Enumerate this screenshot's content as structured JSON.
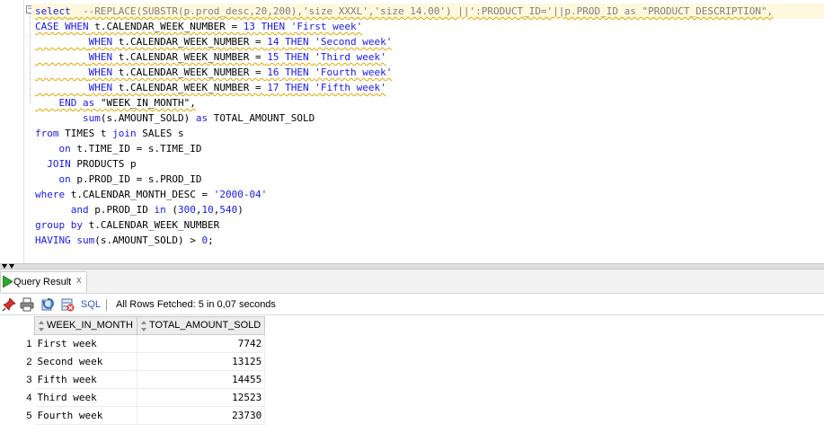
{
  "editor": {
    "lines": [
      {
        "segs": [
          [
            "kw",
            "select"
          ],
          [
            "",
            "  "
          ],
          [
            "cm",
            "--REPLACE(SUBSTR(p.prod_desc,20,200),'size XXXL','size 14.00') ||':PRODUCT_ID='||p.PROD_ID as \"PRODUCT_DESCRIPTION\","
          ]
        ],
        "hl": true,
        "squiggle": true
      },
      {
        "segs": [
          [
            "kw",
            "CASE WHEN"
          ],
          [
            "",
            " t.CALENDAR_WEEK_NUMBER = "
          ],
          [
            "num",
            "13"
          ],
          [
            "kw",
            " THEN "
          ],
          [
            "str",
            "'First week'"
          ]
        ],
        "hl": false,
        "squiggle": true
      },
      {
        "segs": [
          [
            "",
            "         "
          ],
          [
            "kw",
            "WHEN"
          ],
          [
            "",
            " t.CALENDAR_WEEK_NUMBER = "
          ],
          [
            "num",
            "14"
          ],
          [
            "kw",
            " THEN "
          ],
          [
            "str",
            "'Second week'"
          ]
        ],
        "hl": false,
        "squiggle": true
      },
      {
        "segs": [
          [
            "",
            "         "
          ],
          [
            "kw",
            "WHEN"
          ],
          [
            "",
            " t.CALENDAR_WEEK_NUMBER = "
          ],
          [
            "num",
            "15"
          ],
          [
            "kw",
            " THEN "
          ],
          [
            "str",
            "'Third week'"
          ]
        ],
        "hl": false,
        "squiggle": true
      },
      {
        "segs": [
          [
            "",
            "         "
          ],
          [
            "kw",
            "WHEN"
          ],
          [
            "",
            " t.CALENDAR_WEEK_NUMBER = "
          ],
          [
            "num",
            "16"
          ],
          [
            "kw",
            " THEN "
          ],
          [
            "str",
            "'Fourth week'"
          ]
        ],
        "hl": false,
        "squiggle": true
      },
      {
        "segs": [
          [
            "",
            "         "
          ],
          [
            "kw",
            "WHEN"
          ],
          [
            "",
            " t.CALENDAR_WEEK_NUMBER = "
          ],
          [
            "num",
            "17"
          ],
          [
            "kw",
            " THEN "
          ],
          [
            "str",
            "'Fifth week'"
          ]
        ],
        "hl": false,
        "squiggle": true
      },
      {
        "segs": [
          [
            "",
            "    "
          ],
          [
            "kw",
            "END"
          ],
          [
            "kw",
            " as "
          ],
          [
            "",
            "\"WEEK_IN_MONTH\","
          ]
        ],
        "hl": false,
        "squiggle": true
      },
      {
        "segs": [
          [
            "",
            "        "
          ],
          [
            "kw",
            "sum"
          ],
          [
            "",
            "(s.AMOUNT_SOLD) "
          ],
          [
            "kw",
            "as"
          ],
          [
            "",
            " TOTAL_AMOUNT_SOLD"
          ]
        ],
        "hl": false,
        "squiggle": false
      },
      {
        "segs": [
          [
            "kw",
            "from"
          ],
          [
            "",
            " TIMES t "
          ],
          [
            "kw",
            "join"
          ],
          [
            "",
            " SALES s"
          ]
        ],
        "hl": false,
        "squiggle": false
      },
      {
        "segs": [
          [
            "",
            "    "
          ],
          [
            "kw",
            "on"
          ],
          [
            "",
            " t.TIME_ID = s.TIME_ID"
          ]
        ],
        "hl": false,
        "squiggle": false
      },
      {
        "segs": [
          [
            "",
            "  "
          ],
          [
            "kw",
            "JOIN"
          ],
          [
            "",
            " PRODUCTS p"
          ]
        ],
        "hl": false,
        "squiggle": false
      },
      {
        "segs": [
          [
            "",
            "    "
          ],
          [
            "kw",
            "on"
          ],
          [
            "",
            " p.PROD_ID = s.PROD_ID"
          ]
        ],
        "hl": false,
        "squiggle": false
      },
      {
        "segs": [
          [
            "kw",
            "where"
          ],
          [
            "",
            " t.CALENDAR_MONTH_DESC = "
          ],
          [
            "str",
            "'2000-04'"
          ]
        ],
        "hl": false,
        "squiggle": false
      },
      {
        "segs": [
          [
            "",
            "      "
          ],
          [
            "kw",
            "and"
          ],
          [
            "",
            " p.PROD_ID "
          ],
          [
            "kw",
            "in"
          ],
          [
            "",
            " ("
          ],
          [
            "num",
            "300"
          ],
          [
            "",
            ","
          ],
          [
            "num",
            "10"
          ],
          [
            "",
            ","
          ],
          [
            "num",
            "540"
          ],
          [
            "",
            ")"
          ]
        ],
        "hl": false,
        "squiggle": false
      },
      {
        "segs": [
          [
            "kw",
            "group by"
          ],
          [
            "",
            " t.CALENDAR_WEEK_NUMBER"
          ]
        ],
        "hl": false,
        "squiggle": false
      },
      {
        "segs": [
          [
            "kw",
            "HAVING"
          ],
          [
            " ",
            " "
          ],
          [
            "kw",
            "sum"
          ],
          [
            "",
            "(s.AMOUNT_SOLD) > "
          ],
          [
            "num",
            "0"
          ],
          [
            "",
            ";"
          ]
        ],
        "hl": false,
        "squiggle": false
      }
    ]
  },
  "result_tab": {
    "label": "Query Result",
    "close": "x"
  },
  "toolbar": {
    "sql_label": "SQL",
    "status": "All Rows Fetched: 5 in 0,07 seconds"
  },
  "grid": {
    "columns": [
      "WEEK_IN_MONTH",
      "TOTAL_AMOUNT_SOLD"
    ],
    "rows": [
      {
        "n": "1",
        "week": "First week",
        "amount": "7742"
      },
      {
        "n": "2",
        "week": "Second week",
        "amount": "13125"
      },
      {
        "n": "3",
        "week": "Fifth week",
        "amount": "14455"
      },
      {
        "n": "4",
        "week": "Third week",
        "amount": "12523"
      },
      {
        "n": "5",
        "week": "Fourth week",
        "amount": "23730"
      }
    ]
  },
  "colors": {
    "keyword": "#1a1ae6",
    "comment": "#7f7f7f",
    "highlight_line": "#fff8dc",
    "squiggle": "#e0a800"
  }
}
